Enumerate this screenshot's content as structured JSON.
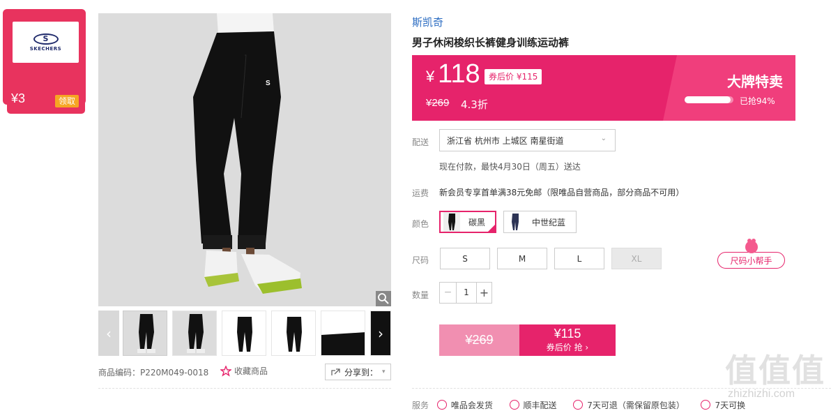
{
  "coupon": {
    "brand_logo_text": "SKECHERS",
    "amount": "¥3",
    "claim": "领取"
  },
  "product": {
    "brand": "斯凯奇",
    "title": "男子休闲梭织长裤健身训练运动裤",
    "code": "商品编码：P220M049-0018",
    "favorite": "收藏商品",
    "share": "分享到：",
    "colors": {
      "accent": "#e6236b",
      "link": "#2a6bc1"
    }
  },
  "price": {
    "currency": "¥",
    "current": "118",
    "after_coupon_tag": "券后价 ¥115",
    "original": "¥269",
    "discount": "4.3折",
    "promo_title": "大牌特卖",
    "sold_label": "已抢94%",
    "sold_fraction": 0.94
  },
  "delivery": {
    "label": "配送",
    "address": "浙江省 杭州市 上城区 南星街道",
    "eta": "现在付款，最快4月30日（周五）送达"
  },
  "shipping": {
    "label": "运费",
    "text": "新会员专享首单满38元免邮（限唯品自营商品，部分商品不可用）"
  },
  "color": {
    "label": "颜色",
    "options": [
      {
        "name": "碳黑",
        "selected": true
      },
      {
        "name": "中世纪蓝",
        "selected": false
      }
    ]
  },
  "size": {
    "label": "尺码",
    "options": [
      "S",
      "M",
      "L",
      "XL"
    ],
    "helper": "尺码小帮手"
  },
  "quantity": {
    "label": "数量",
    "value": "1",
    "minus": "−",
    "plus": "+"
  },
  "buy": {
    "original": "¥269",
    "coupon_price": "¥115",
    "coupon_action": "券后价 抢 ›"
  },
  "services": {
    "label": "服务",
    "items": [
      "唯品会发货",
      "顺丰配送",
      "7天可退（需保留原包装）",
      "7天可换"
    ]
  },
  "watermark": {
    "text": "值值值",
    "url": "zhizhizhi.com"
  }
}
